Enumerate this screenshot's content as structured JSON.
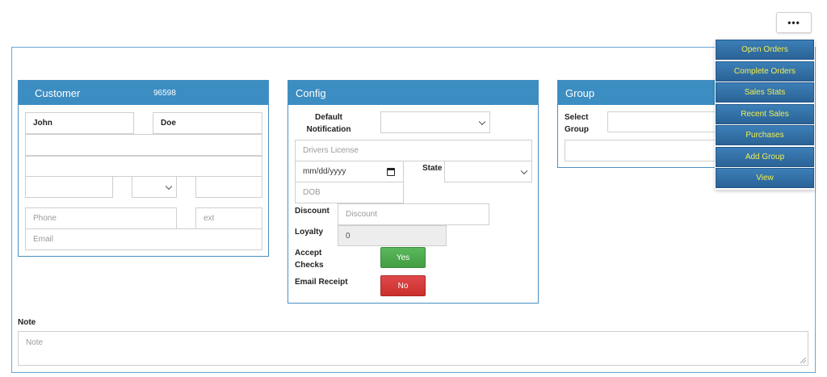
{
  "toolbar": {
    "more_label": "•••"
  },
  "customer": {
    "title": "Customer",
    "id": "96598",
    "first_name": "John",
    "last_name": "Doe",
    "address1": "",
    "address2": "",
    "city": "",
    "state": "",
    "zip": "",
    "phone_placeholder": "Phone",
    "ext_placeholder": "ext",
    "email_placeholder": "Email"
  },
  "config": {
    "title": "Config",
    "default_notification_label": "Default Notification",
    "default_notification_value": "",
    "drivers_license_placeholder": "Drivers License",
    "date_placeholder": "mm/dd/yyyy",
    "state_label": "State",
    "state_value": "",
    "dob_placeholder": "DOB",
    "discount_label": "Discount",
    "discount_placeholder": "Discount",
    "loyalty_label": "Loyalty",
    "loyalty_value": "0",
    "accept_checks_label": "Accept Checks",
    "accept_checks_button": "Yes",
    "email_receipt_label": "Email Receipt",
    "email_receipt_button": "No"
  },
  "group": {
    "title": "Group",
    "select_group_label": "Select Group",
    "select_group_value": "",
    "group_input_value": ""
  },
  "note": {
    "label": "Note",
    "placeholder": "Note"
  },
  "menu": {
    "items": [
      {
        "label": "Open Orders"
      },
      {
        "label": "Complete Orders"
      },
      {
        "label": "Sales Stats"
      },
      {
        "label": "Recent Sales"
      },
      {
        "label": "Purchases"
      },
      {
        "label": "Add Group"
      },
      {
        "label": "View"
      }
    ]
  },
  "colors": {
    "panel_header": "#3c8dc2",
    "menu_bg": "#2a6396",
    "menu_text": "#f2ee4f",
    "yes": "#5cb85c",
    "no": "#d9534f"
  }
}
